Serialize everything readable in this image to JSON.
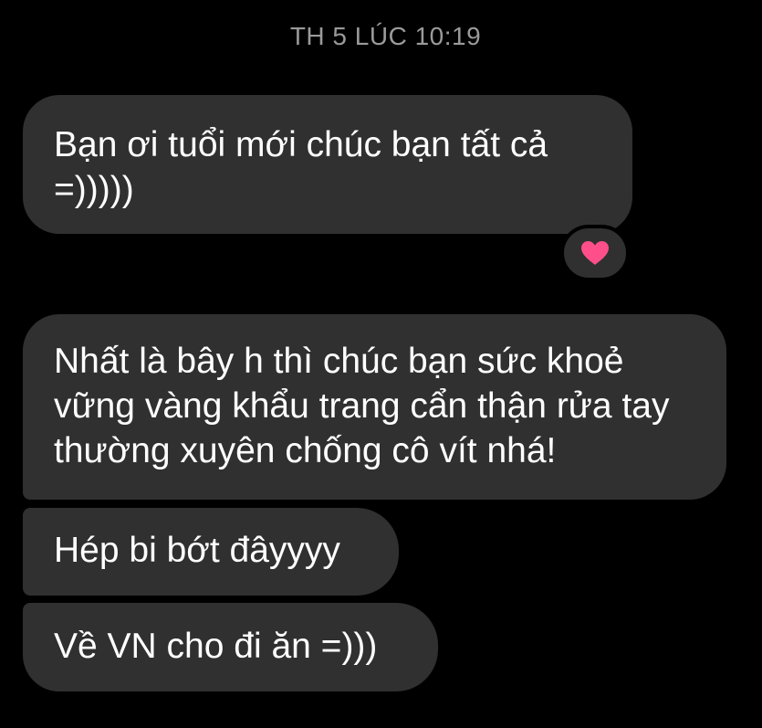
{
  "conversation": {
    "timestamp": "TH 5 LÚC 10:19",
    "messages": [
      {
        "text": "Bạn ơi tuổi mới chúc bạn tất cả =)))))"
      },
      {
        "text": "Nhất là bây h thì chúc bạn sức khoẻ vững vàng khẩu trang cẩn thận rửa tay thường xuyên chống cô vít nhá!"
      },
      {
        "text": "Hép bi bớt đâyyyy"
      },
      {
        "text": "Về VN cho đi ăn =)))"
      }
    ],
    "reaction": {
      "icon": "heart-icon",
      "color": "#ff4f8b"
    }
  },
  "colors": {
    "background": "#000000",
    "bubble": "#303030",
    "text": "#ffffff",
    "timestamp": "#9a9a9a"
  }
}
